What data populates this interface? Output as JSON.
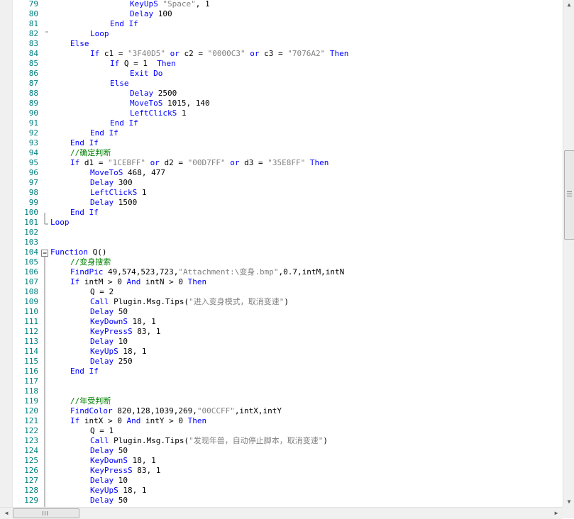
{
  "editor": {
    "lines": [
      {
        "n": "79",
        "indent": 4,
        "tokens": [
          {
            "t": "KeyUpS ",
            "c": "k"
          },
          {
            "t": "\"Space\"",
            "c": "s"
          },
          {
            "t": ", 1",
            "c": ""
          }
        ]
      },
      {
        "n": "80",
        "indent": 4,
        "tokens": [
          {
            "t": "Delay ",
            "c": "k"
          },
          {
            "t": "100",
            "c": ""
          }
        ]
      },
      {
        "n": "81",
        "indent": 3,
        "tokens": [
          {
            "t": "End If",
            "c": "k"
          }
        ]
      },
      {
        "n": "82",
        "indent": 2,
        "tokens": [
          {
            "t": "Loop",
            "c": "k"
          }
        ]
      },
      {
        "n": "83",
        "indent": 1,
        "tokens": [
          {
            "t": "Else",
            "c": "k"
          }
        ]
      },
      {
        "n": "84",
        "indent": 2,
        "tokens": [
          {
            "t": "If ",
            "c": "k"
          },
          {
            "t": "c1 = ",
            "c": ""
          },
          {
            "t": "\"3F40D5\"",
            "c": "s"
          },
          {
            "t": " or ",
            "c": "k"
          },
          {
            "t": "c2 = ",
            "c": ""
          },
          {
            "t": "\"0000C3\"",
            "c": "s"
          },
          {
            "t": " or ",
            "c": "k"
          },
          {
            "t": "c3 = ",
            "c": ""
          },
          {
            "t": "\"7076A2\"",
            "c": "s"
          },
          {
            "t": " Then",
            "c": "k"
          }
        ]
      },
      {
        "n": "85",
        "indent": 3,
        "tokens": [
          {
            "t": "If ",
            "c": "k"
          },
          {
            "t": "Q = 1  ",
            "c": ""
          },
          {
            "t": "Then",
            "c": "k"
          }
        ]
      },
      {
        "n": "86",
        "indent": 4,
        "tokens": [
          {
            "t": "Exit Do",
            "c": "k"
          }
        ]
      },
      {
        "n": "87",
        "indent": 3,
        "tokens": [
          {
            "t": "Else",
            "c": "k"
          }
        ]
      },
      {
        "n": "88",
        "indent": 4,
        "tokens": [
          {
            "t": "Delay ",
            "c": "k"
          },
          {
            "t": "2500",
            "c": ""
          }
        ]
      },
      {
        "n": "89",
        "indent": 4,
        "tokens": [
          {
            "t": "MoveToS ",
            "c": "k"
          },
          {
            "t": "1015, 140",
            "c": ""
          }
        ]
      },
      {
        "n": "90",
        "indent": 4,
        "tokens": [
          {
            "t": "LeftClickS ",
            "c": "k"
          },
          {
            "t": "1",
            "c": ""
          }
        ]
      },
      {
        "n": "91",
        "indent": 3,
        "tokens": [
          {
            "t": "End If",
            "c": "k"
          }
        ]
      },
      {
        "n": "92",
        "indent": 2,
        "tokens": [
          {
            "t": "End If",
            "c": "k"
          }
        ]
      },
      {
        "n": "93",
        "indent": 1,
        "tokens": [
          {
            "t": "End If",
            "c": "k"
          }
        ]
      },
      {
        "n": "94",
        "indent": 1,
        "tokens": [
          {
            "t": "//确定判断",
            "c": "c"
          }
        ]
      },
      {
        "n": "95",
        "indent": 1,
        "tokens": [
          {
            "t": "If ",
            "c": "k"
          },
          {
            "t": "d1 = ",
            "c": ""
          },
          {
            "t": "\"1CEBFF\"",
            "c": "s"
          },
          {
            "t": " or ",
            "c": "k"
          },
          {
            "t": "d2 = ",
            "c": ""
          },
          {
            "t": "\"00D7FF\"",
            "c": "s"
          },
          {
            "t": " or ",
            "c": "k"
          },
          {
            "t": "d3 = ",
            "c": ""
          },
          {
            "t": "\"35E8FF\"",
            "c": "s"
          },
          {
            "t": " Then",
            "c": "k"
          }
        ]
      },
      {
        "n": "96",
        "indent": 2,
        "tokens": [
          {
            "t": "MoveToS ",
            "c": "k"
          },
          {
            "t": "468, 477",
            "c": ""
          }
        ]
      },
      {
        "n": "97",
        "indent": 2,
        "tokens": [
          {
            "t": "Delay ",
            "c": "k"
          },
          {
            "t": "300",
            "c": ""
          }
        ]
      },
      {
        "n": "98",
        "indent": 2,
        "tokens": [
          {
            "t": "LeftClickS ",
            "c": "k"
          },
          {
            "t": "1",
            "c": ""
          }
        ]
      },
      {
        "n": "99",
        "indent": 2,
        "tokens": [
          {
            "t": "Delay ",
            "c": "k"
          },
          {
            "t": "1500",
            "c": ""
          }
        ]
      },
      {
        "n": "100",
        "indent": 1,
        "tokens": [
          {
            "t": "End If",
            "c": "k"
          }
        ]
      },
      {
        "n": "101",
        "indent": 0,
        "tokens": [
          {
            "t": "Loop",
            "c": "k"
          }
        ]
      },
      {
        "n": "102",
        "indent": 0,
        "tokens": []
      },
      {
        "n": "103",
        "indent": 0,
        "tokens": []
      },
      {
        "n": "104",
        "indent": 0,
        "tokens": [
          {
            "t": "Function ",
            "c": "k"
          },
          {
            "t": "Q()",
            "c": ""
          }
        ]
      },
      {
        "n": "105",
        "indent": 1,
        "tokens": [
          {
            "t": "//变身搜索",
            "c": "c"
          }
        ]
      },
      {
        "n": "106",
        "indent": 1,
        "tokens": [
          {
            "t": "FindPic ",
            "c": "k"
          },
          {
            "t": "49,574,523,723,",
            "c": ""
          },
          {
            "t": "\"Attachment:\\变身.bmp\"",
            "c": "s"
          },
          {
            "t": ",0.7,intM,intN",
            "c": ""
          }
        ]
      },
      {
        "n": "107",
        "indent": 1,
        "tokens": [
          {
            "t": "If ",
            "c": "k"
          },
          {
            "t": "intM > 0 ",
            "c": ""
          },
          {
            "t": "And ",
            "c": "k"
          },
          {
            "t": "intN > 0 ",
            "c": ""
          },
          {
            "t": "Then",
            "c": "k"
          }
        ]
      },
      {
        "n": "108",
        "indent": 2,
        "tokens": [
          {
            "t": "Q = 2",
            "c": ""
          }
        ]
      },
      {
        "n": "109",
        "indent": 2,
        "tokens": [
          {
            "t": "Call ",
            "c": "k"
          },
          {
            "t": "Plugin.Msg.Tips(",
            "c": ""
          },
          {
            "t": "\"进入变身模式，取消变速\"",
            "c": "s"
          },
          {
            "t": ")",
            "c": ""
          }
        ]
      },
      {
        "n": "110",
        "indent": 2,
        "tokens": [
          {
            "t": "Delay ",
            "c": "k"
          },
          {
            "t": "50",
            "c": ""
          }
        ]
      },
      {
        "n": "111",
        "indent": 2,
        "tokens": [
          {
            "t": "KeyDownS ",
            "c": "k"
          },
          {
            "t": "18, 1",
            "c": ""
          }
        ]
      },
      {
        "n": "112",
        "indent": 2,
        "tokens": [
          {
            "t": "KeyPressS ",
            "c": "k"
          },
          {
            "t": "83, 1",
            "c": ""
          }
        ]
      },
      {
        "n": "113",
        "indent": 2,
        "tokens": [
          {
            "t": "Delay ",
            "c": "k"
          },
          {
            "t": "10",
            "c": ""
          }
        ]
      },
      {
        "n": "114",
        "indent": 2,
        "tokens": [
          {
            "t": "KeyUpS ",
            "c": "k"
          },
          {
            "t": "18, 1",
            "c": ""
          }
        ]
      },
      {
        "n": "115",
        "indent": 2,
        "tokens": [
          {
            "t": "Delay ",
            "c": "k"
          },
          {
            "t": "250",
            "c": ""
          }
        ]
      },
      {
        "n": "116",
        "indent": 1,
        "tokens": [
          {
            "t": "End If",
            "c": "k"
          }
        ]
      },
      {
        "n": "117",
        "indent": 0,
        "tokens": []
      },
      {
        "n": "118",
        "indent": 0,
        "tokens": []
      },
      {
        "n": "119",
        "indent": 1,
        "tokens": [
          {
            "t": "//年受判断",
            "c": "c"
          }
        ]
      },
      {
        "n": "120",
        "indent": 1,
        "tokens": [
          {
            "t": "FindColor ",
            "c": "k"
          },
          {
            "t": "820,128,1039,269,",
            "c": ""
          },
          {
            "t": "\"00CCFF\"",
            "c": "s"
          },
          {
            "t": ",intX,intY",
            "c": ""
          }
        ]
      },
      {
        "n": "121",
        "indent": 1,
        "tokens": [
          {
            "t": "If ",
            "c": "k"
          },
          {
            "t": "intX > 0 ",
            "c": ""
          },
          {
            "t": "And ",
            "c": "k"
          },
          {
            "t": "intY > 0 ",
            "c": ""
          },
          {
            "t": "Then",
            "c": "k"
          }
        ]
      },
      {
        "n": "122",
        "indent": 2,
        "tokens": [
          {
            "t": "Q = 1",
            "c": ""
          }
        ]
      },
      {
        "n": "123",
        "indent": 2,
        "tokens": [
          {
            "t": "Call ",
            "c": "k"
          },
          {
            "t": "Plugin.Msg.Tips(",
            "c": ""
          },
          {
            "t": "\"发现年兽，自动停止脚本，取消变速\"",
            "c": "s"
          },
          {
            "t": ")",
            "c": ""
          }
        ]
      },
      {
        "n": "124",
        "indent": 2,
        "tokens": [
          {
            "t": "Delay ",
            "c": "k"
          },
          {
            "t": "50",
            "c": ""
          }
        ]
      },
      {
        "n": "125",
        "indent": 2,
        "tokens": [
          {
            "t": "KeyDownS ",
            "c": "k"
          },
          {
            "t": "18, 1",
            "c": ""
          }
        ]
      },
      {
        "n": "126",
        "indent": 2,
        "tokens": [
          {
            "t": "KeyPressS ",
            "c": "k"
          },
          {
            "t": "83, 1",
            "c": ""
          }
        ]
      },
      {
        "n": "127",
        "indent": 2,
        "tokens": [
          {
            "t": "Delay ",
            "c": "k"
          },
          {
            "t": "10",
            "c": ""
          }
        ]
      },
      {
        "n": "128",
        "indent": 2,
        "tokens": [
          {
            "t": "KeyUpS ",
            "c": "k"
          },
          {
            "t": "18, 1",
            "c": ""
          }
        ]
      },
      {
        "n": "129",
        "indent": 2,
        "tokens": [
          {
            "t": "Delay ",
            "c": "k"
          },
          {
            "t": "50",
            "c": ""
          }
        ]
      }
    ]
  },
  "colors": {
    "keyword": "#0000ff",
    "comment": "#008000",
    "string": "#808080",
    "line_number": "#008080",
    "text": "#000000"
  },
  "icons": {
    "fold_toggle": "minus-box-icon",
    "scroll_up": "arrow-up-icon",
    "scroll_down": "arrow-down-icon",
    "scroll_left": "arrow-left-icon",
    "scroll_right": "arrow-right-icon"
  }
}
